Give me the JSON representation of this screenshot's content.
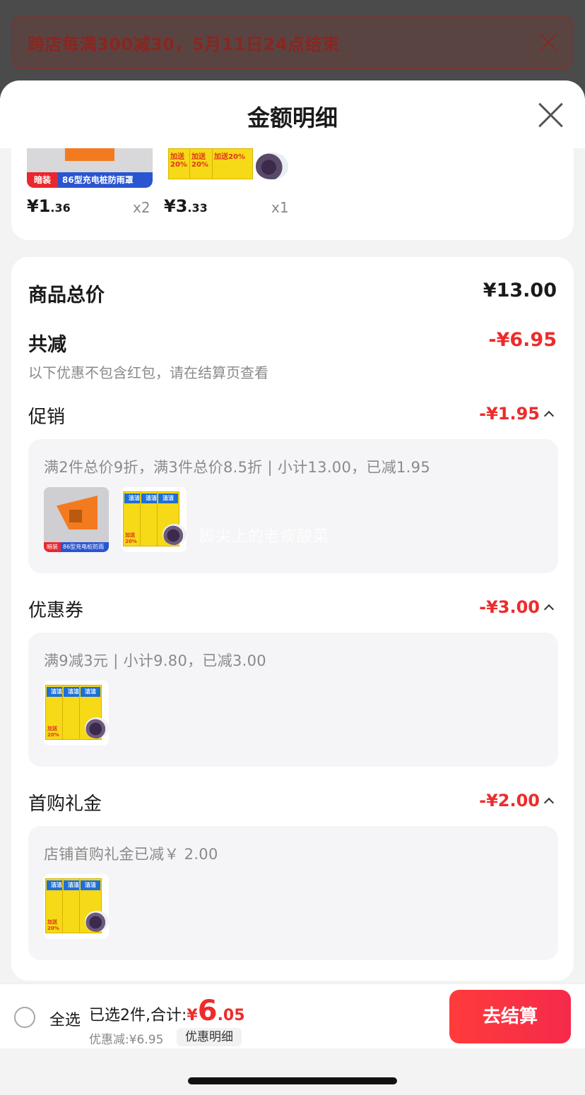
{
  "promo_banner": {
    "text": "跨店每满300减30，5月11日24点结束"
  },
  "sheet": {
    "title": "金额明细"
  },
  "items": [
    {
      "tag": "暗装",
      "label": "86型充电桩防雨罩",
      "price_int": "¥1",
      "price_dec": ".36",
      "qty": "x2"
    },
    {
      "badge": "加送20%",
      "price_int": "¥3",
      "price_dec": ".33",
      "qty": "x1"
    }
  ],
  "totals": {
    "goods_label": "商品总价",
    "goods_value": "¥13.00",
    "reduce_label": "共减",
    "reduce_value": "-¥6.95",
    "reduce_note": "以下优惠不包含红包，请在结算页查看"
  },
  "discounts": [
    {
      "label": "促销",
      "value": "-¥1.95",
      "detail": "满2件总价9折，满3件总价8.5折 | 小计13.00，已减1.95"
    },
    {
      "label": "优惠券",
      "value": "-¥3.00",
      "detail": "满9减3元 | 小计9.80，已减3.00"
    },
    {
      "label": "首购礼金",
      "value": "-¥2.00",
      "detail": "店铺首购礼金已减￥ 2.00"
    }
  ],
  "thumb_text": {
    "charger_tag": "暗装",
    "charger_label": "86型充电桩防雨罩",
    "bag_brand": "洁洁",
    "bag_badge": "加送20%"
  },
  "watermark": "脚尖上的老痰酸菜",
  "bottom": {
    "select_all": "全选",
    "summary_prefix": "已选2件,合计:",
    "total_symbol": "¥",
    "total_int": "6",
    "total_dec": ".05",
    "discount_text": "优惠减:¥6.95",
    "detail_chip": "优惠明细",
    "checkout": "去结算"
  },
  "colors": {
    "accent_red": "#ee2b2b",
    "checkout_gradient": [
      "#ff3b3b",
      "#f52a4a"
    ]
  }
}
